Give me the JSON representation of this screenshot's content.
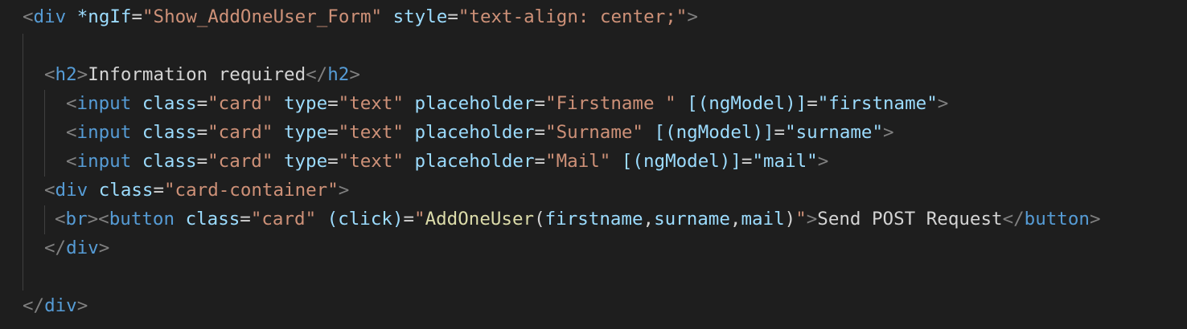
{
  "editor": {
    "lines": [
      {
        "indent": 28,
        "tokens": [
          {
            "t": "<",
            "c": "bracket"
          },
          {
            "t": "div",
            "c": "tag"
          },
          {
            "t": " ",
            "c": "text"
          },
          {
            "t": "*ngIf",
            "c": "attr"
          },
          {
            "t": "=",
            "c": "punct"
          },
          {
            "t": "\"Show_AddOneUser_Form\"",
            "c": "str"
          },
          {
            "t": " ",
            "c": "text"
          },
          {
            "t": "style",
            "c": "attr"
          },
          {
            "t": "=",
            "c": "punct"
          },
          {
            "t": "\"text-align: center;\"",
            "c": "str"
          },
          {
            "t": ">",
            "c": "bracket"
          }
        ]
      },
      {
        "indent": 28,
        "tokens": []
      },
      {
        "indent": 55,
        "tokens": [
          {
            "t": "<",
            "c": "bracket"
          },
          {
            "t": "h2",
            "c": "tag"
          },
          {
            "t": ">",
            "c": "bracket"
          },
          {
            "t": "Information required",
            "c": "text"
          },
          {
            "t": "</",
            "c": "bracket"
          },
          {
            "t": "h2",
            "c": "tag"
          },
          {
            "t": ">",
            "c": "bracket"
          }
        ]
      },
      {
        "indent": 82,
        "tokens": [
          {
            "t": "<",
            "c": "bracket"
          },
          {
            "t": "input",
            "c": "tag"
          },
          {
            "t": " ",
            "c": "text"
          },
          {
            "t": "class",
            "c": "attr"
          },
          {
            "t": "=",
            "c": "punct"
          },
          {
            "t": "\"card\"",
            "c": "str"
          },
          {
            "t": " ",
            "c": "text"
          },
          {
            "t": "type",
            "c": "attr"
          },
          {
            "t": "=",
            "c": "punct"
          },
          {
            "t": "\"text\"",
            "c": "str"
          },
          {
            "t": " ",
            "c": "text"
          },
          {
            "t": "placeholder",
            "c": "attr"
          },
          {
            "t": "=",
            "c": "punct"
          },
          {
            "t": "\"Firstname \"",
            "c": "str"
          },
          {
            "t": " ",
            "c": "text"
          },
          {
            "t": "[(ngModel)]",
            "c": "attr"
          },
          {
            "t": "=",
            "c": "punct"
          },
          {
            "t": "\"firstname\"",
            "c": "attr"
          },
          {
            "t": ">",
            "c": "bracket"
          }
        ]
      },
      {
        "indent": 82,
        "tokens": [
          {
            "t": "<",
            "c": "bracket"
          },
          {
            "t": "input",
            "c": "tag"
          },
          {
            "t": " ",
            "c": "text"
          },
          {
            "t": "class",
            "c": "attr"
          },
          {
            "t": "=",
            "c": "punct"
          },
          {
            "t": "\"card\"",
            "c": "str"
          },
          {
            "t": " ",
            "c": "text"
          },
          {
            "t": "type",
            "c": "attr"
          },
          {
            "t": "=",
            "c": "punct"
          },
          {
            "t": "\"text\"",
            "c": "str"
          },
          {
            "t": " ",
            "c": "text"
          },
          {
            "t": "placeholder",
            "c": "attr"
          },
          {
            "t": "=",
            "c": "punct"
          },
          {
            "t": "\"Surname\"",
            "c": "str"
          },
          {
            "t": " ",
            "c": "text"
          },
          {
            "t": "[(ngModel)]",
            "c": "attr"
          },
          {
            "t": "=",
            "c": "punct"
          },
          {
            "t": "\"surname\"",
            "c": "attr"
          },
          {
            "t": ">",
            "c": "bracket"
          }
        ]
      },
      {
        "indent": 82,
        "tokens": [
          {
            "t": "<",
            "c": "bracket"
          },
          {
            "t": "input",
            "c": "tag"
          },
          {
            "t": " ",
            "c": "text"
          },
          {
            "t": "class",
            "c": "attr"
          },
          {
            "t": "=",
            "c": "punct"
          },
          {
            "t": "\"card\"",
            "c": "str"
          },
          {
            "t": " ",
            "c": "text"
          },
          {
            "t": "type",
            "c": "attr"
          },
          {
            "t": "=",
            "c": "punct"
          },
          {
            "t": "\"text\"",
            "c": "str"
          },
          {
            "t": " ",
            "c": "text"
          },
          {
            "t": "placeholder",
            "c": "attr"
          },
          {
            "t": "=",
            "c": "punct"
          },
          {
            "t": "\"Mail\"",
            "c": "str"
          },
          {
            "t": " ",
            "c": "text"
          },
          {
            "t": "[(ngModel)]",
            "c": "attr"
          },
          {
            "t": "=",
            "c": "punct"
          },
          {
            "t": "\"mail\"",
            "c": "attr"
          },
          {
            "t": ">",
            "c": "bracket"
          }
        ]
      },
      {
        "indent": 55,
        "tokens": [
          {
            "t": "<",
            "c": "bracket"
          },
          {
            "t": "div",
            "c": "tag"
          },
          {
            "t": " ",
            "c": "text"
          },
          {
            "t": "class",
            "c": "attr"
          },
          {
            "t": "=",
            "c": "punct"
          },
          {
            "t": "\"card-container\"",
            "c": "str"
          },
          {
            "t": ">",
            "c": "bracket"
          }
        ]
      },
      {
        "indent": 68,
        "tokens": [
          {
            "t": "<",
            "c": "bracket"
          },
          {
            "t": "br",
            "c": "tag"
          },
          {
            "t": "><",
            "c": "bracket"
          },
          {
            "t": "button",
            "c": "tag"
          },
          {
            "t": " ",
            "c": "text"
          },
          {
            "t": "class",
            "c": "attr"
          },
          {
            "t": "=",
            "c": "punct"
          },
          {
            "t": "\"card\"",
            "c": "str"
          },
          {
            "t": " ",
            "c": "text"
          },
          {
            "t": "(click)",
            "c": "attr"
          },
          {
            "t": "=",
            "c": "punct"
          },
          {
            "t": "\"",
            "c": "str"
          },
          {
            "t": "AddOneUser",
            "c": "fn"
          },
          {
            "t": "(",
            "c": "punct"
          },
          {
            "t": "firstname",
            "c": "attr"
          },
          {
            "t": ",",
            "c": "punct"
          },
          {
            "t": "surname",
            "c": "attr"
          },
          {
            "t": ",",
            "c": "punct"
          },
          {
            "t": "mail",
            "c": "attr"
          },
          {
            "t": ")",
            "c": "punct"
          },
          {
            "t": "\"",
            "c": "str"
          },
          {
            "t": ">",
            "c": "bracket"
          },
          {
            "t": "Send POST Request",
            "c": "text"
          },
          {
            "t": "</",
            "c": "bracket"
          },
          {
            "t": "button",
            "c": "tag"
          },
          {
            "t": ">",
            "c": "bracket"
          }
        ]
      },
      {
        "indent": 55,
        "tokens": [
          {
            "t": "</",
            "c": "bracket"
          },
          {
            "t": "div",
            "c": "tag"
          },
          {
            "t": ">",
            "c": "bracket"
          }
        ]
      },
      {
        "indent": 28,
        "tokens": []
      },
      {
        "indent": 28,
        "tokens": [
          {
            "t": "</",
            "c": "bracket"
          },
          {
            "t": "div",
            "c": "tag"
          },
          {
            "t": ">",
            "c": "bracket"
          }
        ]
      }
    ]
  },
  "theme": {
    "background": "#1e1e1e",
    "tag": "#569cd6",
    "attribute": "#9cdcfe",
    "string": "#ce9178",
    "function": "#dcdcaa",
    "bracket": "#808080",
    "text": "#d4d4d4",
    "indent_guide": "#404040"
  }
}
